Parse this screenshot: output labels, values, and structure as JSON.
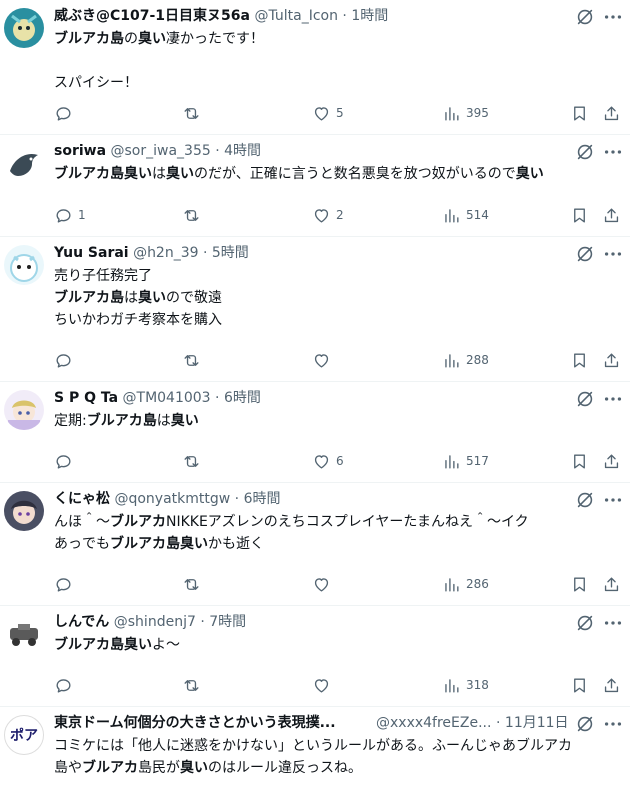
{
  "tweets": [
    {
      "name": "威ぶき@C107-1日目東ヌ56a",
      "handle": "@Tulta_Icon",
      "time": "1時間",
      "avatar_color": "#2a8fa0",
      "body": [
        [
          {
            "t": "ブルアカ島",
            "b": true
          },
          {
            "t": "の",
            "b": false
          },
          {
            "t": "臭い",
            "b": true
          },
          {
            "t": "凄かったです！",
            "b": false
          }
        ],
        [],
        [
          {
            "t": "スパイシー！",
            "b": false
          }
        ]
      ],
      "replies": "",
      "retweets": "",
      "likes": "5",
      "views": "395"
    },
    {
      "name": "soriwa",
      "handle": "@sor_iwa_355",
      "time": "4時間",
      "avatar_color": "#3b4a55",
      "body": [
        [
          {
            "t": "ブルアカ島臭い",
            "b": true
          },
          {
            "t": "は",
            "b": false
          },
          {
            "t": "臭い",
            "b": true
          },
          {
            "t": "のだが、正確に言うと数名悪臭を放つ奴がいるので",
            "b": false
          },
          {
            "t": "臭い",
            "b": true
          }
        ]
      ],
      "replies": "1",
      "retweets": "",
      "likes": "2",
      "views": "514"
    },
    {
      "name": "Yuu Sarai",
      "handle": "@h2n_39",
      "time": "5時間",
      "avatar_color": "#9fd6e8",
      "body": [
        [
          {
            "t": "売り子任務完了",
            "b": false
          }
        ],
        [
          {
            "t": "ブルアカ島",
            "b": true
          },
          {
            "t": "は",
            "b": false
          },
          {
            "t": "臭い",
            "b": true
          },
          {
            "t": "ので敬遠",
            "b": false
          }
        ],
        [
          {
            "t": "ちいかわガチ考察本を購入",
            "b": false
          }
        ]
      ],
      "replies": "",
      "retweets": "",
      "likes": "",
      "views": "288"
    },
    {
      "name": "S P Q Ta",
      "handle": "@TM041003",
      "time": "6時間",
      "avatar_color": "#c9b8e6",
      "body": [
        [
          {
            "t": "定期:",
            "b": false
          },
          {
            "t": "ブルアカ島",
            "b": true
          },
          {
            "t": "は",
            "b": false
          },
          {
            "t": "臭い",
            "b": true
          }
        ]
      ],
      "replies": "",
      "retweets": "",
      "likes": "6",
      "views": "517"
    },
    {
      "name": "くにゃ松",
      "handle": "@qonyatkmttgw",
      "time": "6時間",
      "avatar_color": "#4a4f63",
      "body": [
        [
          {
            "t": "んほ＾～",
            "b": false
          },
          {
            "t": "ブルアカ",
            "b": true
          },
          {
            "t": "NIKKEアズレンのえちコスプレイヤーたまんねえ＾～イク",
            "b": false
          }
        ],
        [
          {
            "t": "あっでも",
            "b": false
          },
          {
            "t": "ブルアカ島臭い",
            "b": true
          },
          {
            "t": "かも逝く",
            "b": false
          }
        ]
      ],
      "replies": "",
      "retweets": "",
      "likes": "",
      "views": "286"
    },
    {
      "name": "しんでん",
      "handle": "@shindenj7",
      "time": "7時間",
      "avatar_color": "#5a5a5a",
      "body": [
        [
          {
            "t": "ブルアカ島臭い",
            "b": true
          },
          {
            "t": "よ～",
            "b": false
          }
        ]
      ],
      "replies": "",
      "retweets": "",
      "likes": "",
      "views": "318"
    },
    {
      "name": "東京ドーム何個分の大きさとかいう表現撲...",
      "handle": "@xxxx4freEZe...",
      "time": "11月11日",
      "avatar_color": "#ffffff",
      "avatar_text": "ポア",
      "body": [
        [
          {
            "t": "コミケには「他人に迷惑をかけない」というルールがある。ふーんじゃあブルアカ",
            "b": false
          }
        ],
        [
          {
            "t": "島",
            "b": false
          },
          {
            "t": "や",
            "b": false
          },
          {
            "t": "ブルアカ",
            "b": true
          },
          {
            "t": "島民が",
            "b": false
          },
          {
            "t": "臭い",
            "b": true
          },
          {
            "t": "のはルール違反っスね。",
            "b": false
          }
        ]
      ],
      "replies": "",
      "retweets": "",
      "likes": "",
      "views": ""
    }
  ],
  "header_sep": "·",
  "icons": {
    "reply": "reply-icon",
    "retweet": "retweet-icon",
    "like": "heart-icon",
    "views": "views-icon",
    "bookmark": "bookmark-icon",
    "share": "share-icon",
    "grok": "grok-icon",
    "more": "more-icon"
  }
}
